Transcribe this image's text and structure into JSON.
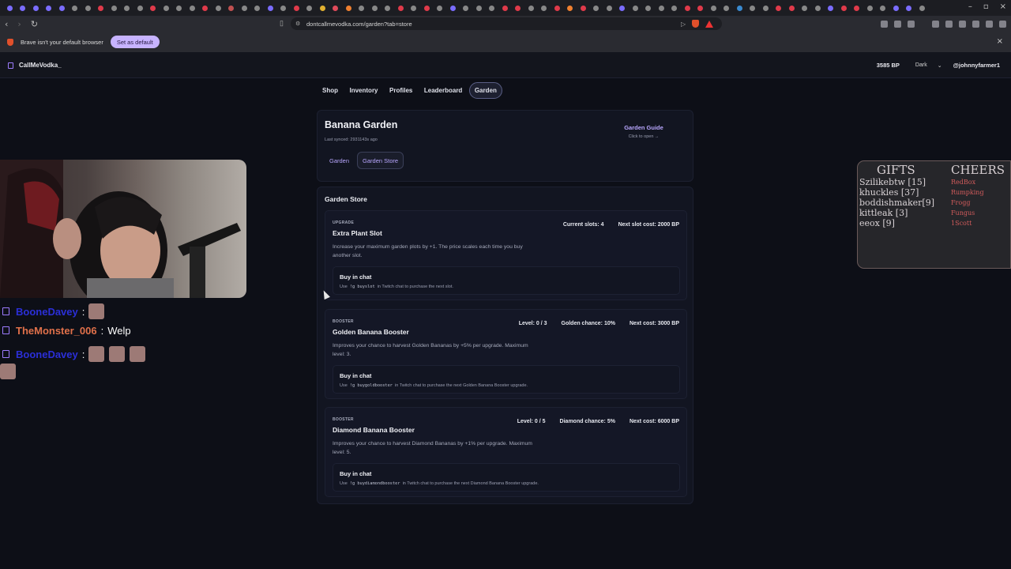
{
  "browser": {
    "tab_dot_colors": [
      "#7a6cff",
      "#7a6cff",
      "#7a6cff",
      "#7a6cff",
      "#7a6cff",
      "#888",
      "#888",
      "#e03a4a",
      "#888",
      "#888",
      "#888",
      "#e03a4a",
      "#888",
      "#888",
      "#888",
      "#e03a4a",
      "#888",
      "#c05050",
      "#888",
      "#888",
      "#7a6cff",
      "#888",
      "#e03a4a",
      "#888",
      "#e0b030",
      "#e04a5a",
      "#f08030",
      "#888",
      "#888",
      "#888",
      "#e03a4a",
      "#888",
      "#e03a4a",
      "#888",
      "#7a6cff",
      "#888",
      "#888",
      "#888",
      "#e03a4a",
      "#e03a4a",
      "#888",
      "#888",
      "#e03a4a",
      "#f08030",
      "#e03a4a",
      "#888",
      "#888",
      "#7a6cff",
      "#888",
      "#888",
      "#888",
      "#888",
      "#e03a4a",
      "#e03a4a",
      "#888",
      "#888",
      "#3a8ad0",
      "#888",
      "#888",
      "#e03a4a",
      "#e03a4a",
      "#888",
      "#888",
      "#7a6cff",
      "#e03a4a",
      "#e03a4a",
      "#888",
      "#888",
      "#7a6cff",
      "#7a6cff",
      "#888"
    ],
    "url": "dontcallmevodka.com/garden?tab=store",
    "infobar_text": "Brave isn't your default browser",
    "set_default_label": "Set as default",
    "close_glyph": "×"
  },
  "site": {
    "brand": "CallMeVodka_",
    "points": "3585 BP",
    "theme": "Dark",
    "user": "@johnnyfarmer1"
  },
  "nav": {
    "tabs": [
      {
        "label": "Shop",
        "active": false
      },
      {
        "label": "Inventory",
        "active": false
      },
      {
        "label": "Profiles",
        "active": false
      },
      {
        "label": "Leaderboard",
        "active": false
      },
      {
        "label": "Garden",
        "active": true
      }
    ]
  },
  "garden": {
    "title": "Banana Garden",
    "last_synced": "Last synced: 2931143s ago",
    "guide_title": "Garden Guide",
    "guide_sub": "Click to open →",
    "subtabs": [
      {
        "label": "Garden",
        "active": false
      },
      {
        "label": "Garden Store",
        "active": true
      }
    ]
  },
  "store": {
    "title": "Garden Store",
    "items": [
      {
        "kind": "UPGRADE",
        "name": "Extra Plant Slot",
        "desc": "Increase your maximum garden plots by +1. The price scales each time you buy another slot.",
        "stats": [
          "Current slots: 4",
          "Next slot cost: 2000 BP"
        ],
        "buy_title": "Buy in chat",
        "buy_prefix": "Use",
        "buy_cmd": "!g buyslot",
        "buy_suffix": "in Twitch chat to purchase the next slot."
      },
      {
        "kind": "BOOSTER",
        "name": "Golden Banana Booster",
        "desc": "Improves your chance to harvest Golden Bananas by +5% per upgrade. Maximum level: 3.",
        "stats": [
          "Level: 0 / 3",
          "Golden chance: 10%",
          "Next cost: 3000 BP"
        ],
        "buy_title": "Buy in chat",
        "buy_prefix": "Use",
        "buy_cmd": "!g buygoldbooster",
        "buy_suffix": "in Twitch chat to purchase the next Golden Banana Booster upgrade."
      },
      {
        "kind": "BOOSTER",
        "name": "Diamond Banana Booster",
        "desc": "Improves your chance to harvest Diamond Bananas by +1% per upgrade. Maximum level: 5.",
        "stats": [
          "Level: 0 / 5",
          "Diamond chance: 5%",
          "Next cost: 6000 BP"
        ],
        "buy_title": "Buy in chat",
        "buy_prefix": "Use",
        "buy_cmd": "!g buydiamondbooster",
        "buy_suffix": "in Twitch chat to purchase the next Diamond Banana Booster upgrade."
      }
    ]
  },
  "overlay_chat": [
    {
      "user": "BooneDavey",
      "color": "#2b2fd8",
      "sep": ":",
      "text": "",
      "emotes": 1
    },
    {
      "user": "TheMonster_006",
      "color": "#e0704a",
      "sep": ":",
      "text": "Welp",
      "emotes": 0
    },
    {
      "user": "BooneDavey",
      "color": "#2b2fd8",
      "sep": ":",
      "text": "",
      "emotes": 3
    }
  ],
  "gifts_board": {
    "header_left": "GIFTS",
    "header_right": "CHEERS",
    "left_lines": [
      "Szilikebtw [15]",
      "khuckles [37]",
      "boddishmaker[9]",
      "kittleak [3]",
      "eeox [9]"
    ],
    "right_lines": [
      "RedBox",
      "Rumpking",
      "Frogg",
      "Fungus",
      "1Scott"
    ]
  }
}
